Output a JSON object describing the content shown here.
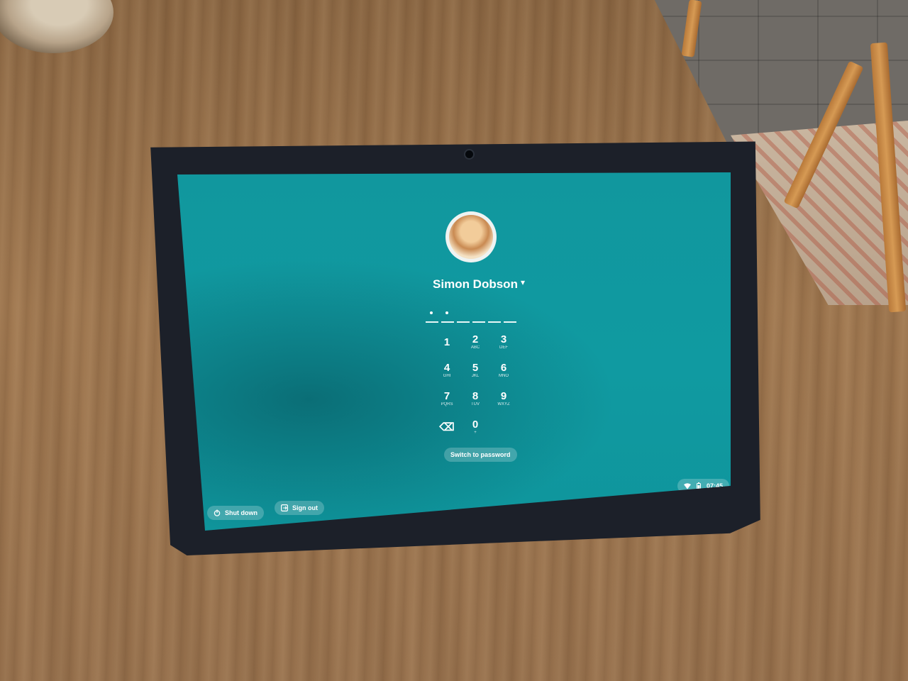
{
  "lock_screen": {
    "user_name": "Simon Dobson",
    "pin_length": 6,
    "pin_entered": 2,
    "keypad": [
      {
        "digit": "1",
        "letters": ""
      },
      {
        "digit": "2",
        "letters": "ABC"
      },
      {
        "digit": "3",
        "letters": "DEF"
      },
      {
        "digit": "4",
        "letters": "GHI"
      },
      {
        "digit": "5",
        "letters": "JKL"
      },
      {
        "digit": "6",
        "letters": "MNO"
      },
      {
        "digit": "7",
        "letters": "PQRS"
      },
      {
        "digit": "8",
        "letters": "TUV"
      },
      {
        "digit": "9",
        "letters": "WXYZ"
      },
      {
        "digit": "⌫",
        "letters": ""
      },
      {
        "digit": "0",
        "letters": "+"
      }
    ],
    "switch_password_label": "Switch to password",
    "shut_down_label": "Shut down",
    "sign_out_label": "Sign out",
    "status_time": "07:45"
  },
  "colors": {
    "screen": "#109aa1",
    "bezel": "#1c2029",
    "text": "#ffffff"
  },
  "icons": {
    "power": "power-icon",
    "sign_out": "sign-out-icon",
    "wifi": "wifi-icon",
    "battery": "battery-icon",
    "dropdown": "chevron-down-icon"
  }
}
